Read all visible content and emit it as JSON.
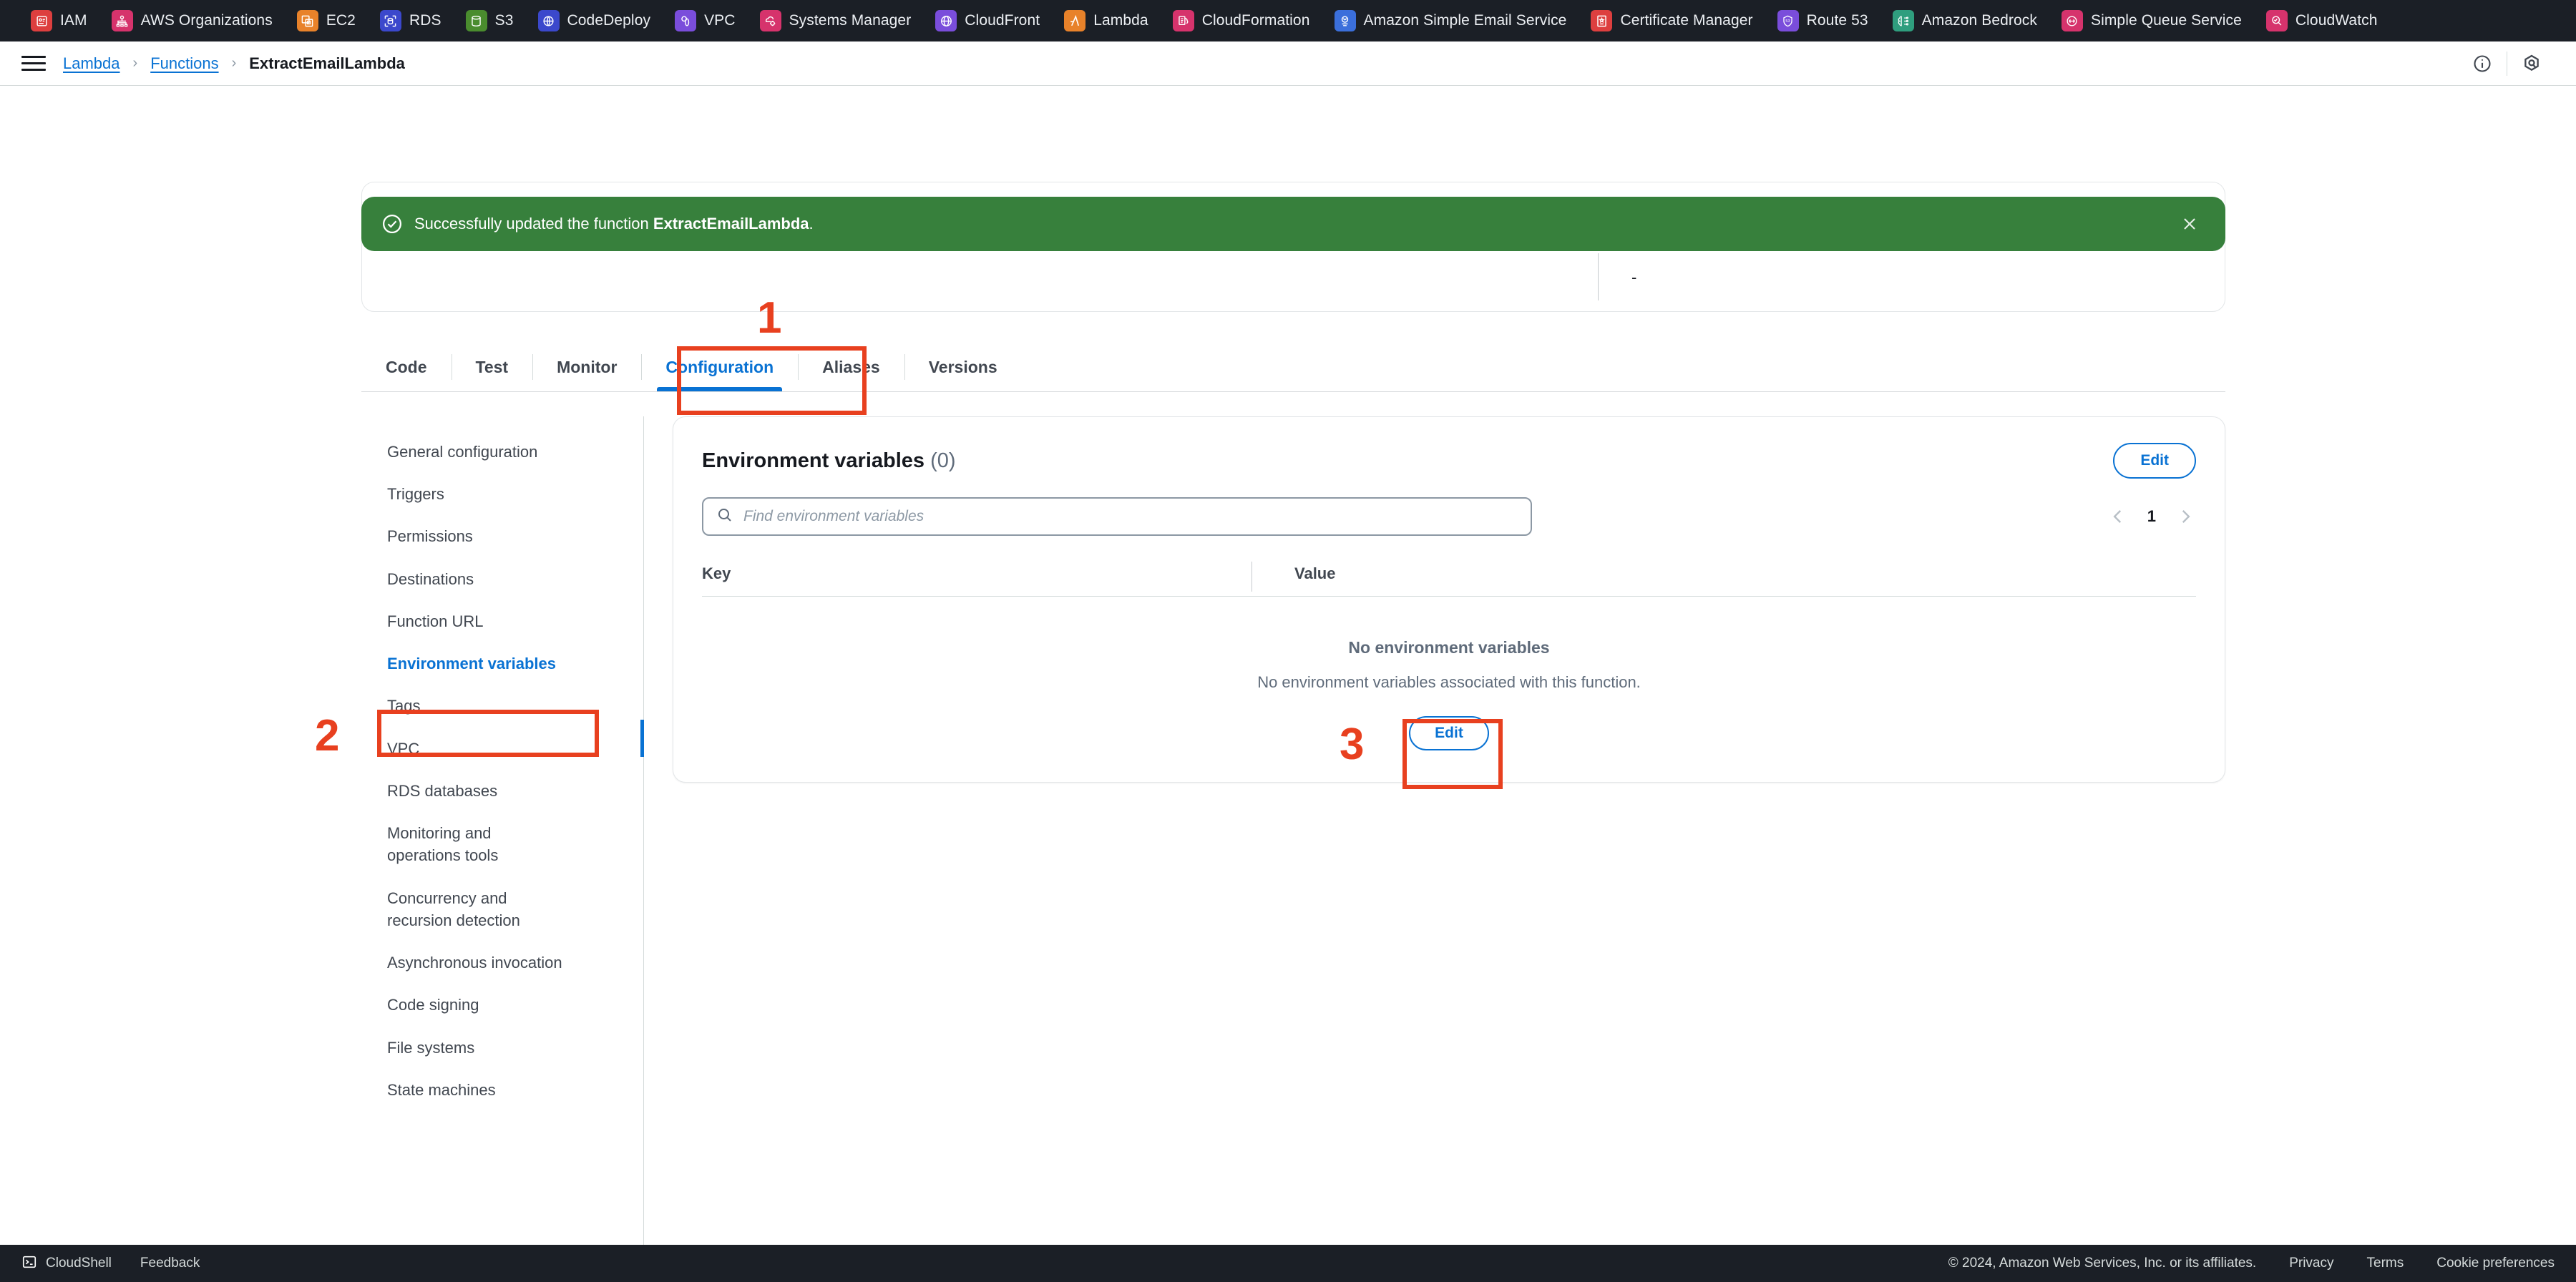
{
  "bookmarks": [
    {
      "label": "IAM",
      "icon": "iam-icon",
      "color": "#dd3f3f"
    },
    {
      "label": "AWS Organizations",
      "icon": "organizations-icon",
      "color": "#d6336c"
    },
    {
      "label": "EC2",
      "icon": "ec2-icon",
      "color": "#e8822a"
    },
    {
      "label": "RDS",
      "icon": "rds-icon",
      "color": "#3b48cc"
    },
    {
      "label": "S3",
      "icon": "s3-icon",
      "color": "#4a8c2e"
    },
    {
      "label": "CodeDeploy",
      "icon": "codedeploy-icon",
      "color": "#3b48cc"
    },
    {
      "label": "VPC",
      "icon": "vpc-icon",
      "color": "#7a4ddb"
    },
    {
      "label": "Systems Manager",
      "icon": "systems-manager-icon",
      "color": "#d6336c"
    },
    {
      "label": "CloudFront",
      "icon": "cloudfront-icon",
      "color": "#7a4ddb"
    },
    {
      "label": "Lambda",
      "icon": "lambda-icon",
      "color": "#e8822a"
    },
    {
      "label": "CloudFormation",
      "icon": "cloudformation-icon",
      "color": "#d6336c"
    },
    {
      "label": "Amazon Simple Email Service",
      "icon": "ses-icon",
      "color": "#3b6fdb"
    },
    {
      "label": "Certificate Manager",
      "icon": "certificate-manager-icon",
      "color": "#dd3f3f"
    },
    {
      "label": "Route 53",
      "icon": "route53-icon",
      "color": "#7a4ddb"
    },
    {
      "label": "Amazon Bedrock",
      "icon": "bedrock-icon",
      "color": "#2f9e7e"
    },
    {
      "label": "Simple Queue Service",
      "icon": "sqs-icon",
      "color": "#d6336c"
    },
    {
      "label": "CloudWatch",
      "icon": "cloudwatch-icon",
      "color": "#d6336c"
    }
  ],
  "header": {
    "menu_icon": "hamburger-icon",
    "breadcrumb": {
      "service": "Lambda",
      "section": "Functions",
      "current": "ExtractEmailLambda",
      "separator": "›"
    },
    "info_icon": "info-icon",
    "settings_icon": "settings-icon"
  },
  "flash": {
    "icon": "success-check-icon",
    "message_prefix": "Successfully updated the function ",
    "message_bold": "ExtractEmailLambda",
    "message_suffix": ".",
    "close_icon": "close-icon",
    "color": "#37803c"
  },
  "ghost": {
    "value": "-"
  },
  "tabs": [
    {
      "label": "Code",
      "active": false
    },
    {
      "label": "Test",
      "active": false
    },
    {
      "label": "Monitor",
      "active": false
    },
    {
      "label": "Configuration",
      "active": true
    },
    {
      "label": "Aliases",
      "active": false
    },
    {
      "label": "Versions",
      "active": false
    }
  ],
  "sidebar": {
    "items": [
      {
        "label": "General configuration",
        "active": false
      },
      {
        "label": "Triggers",
        "active": false
      },
      {
        "label": "Permissions",
        "active": false
      },
      {
        "label": "Destinations",
        "active": false
      },
      {
        "label": "Function URL",
        "active": false
      },
      {
        "label": "Environment variables",
        "active": true
      },
      {
        "label": "Tags",
        "active": false
      },
      {
        "label": "VPC",
        "active": false
      },
      {
        "label": "RDS databases",
        "active": false
      },
      {
        "label": "Monitoring and operations tools",
        "active": false
      },
      {
        "label": "Concurrency and recursion detection",
        "active": false
      },
      {
        "label": "Asynchronous invocation",
        "active": false
      },
      {
        "label": "Code signing",
        "active": false
      },
      {
        "label": "File systems",
        "active": false
      },
      {
        "label": "State machines",
        "active": false
      }
    ]
  },
  "main": {
    "title": "Environment variables",
    "count": "(0)",
    "edit_label": "Edit",
    "search": {
      "icon": "search-icon",
      "placeholder": "Find environment variables",
      "value": ""
    },
    "pagination": {
      "prev_icon": "chevron-left-icon",
      "page": "1",
      "next_icon": "chevron-right-icon"
    },
    "table": {
      "columns": [
        "Key",
        "Value"
      ],
      "rows": []
    },
    "empty_state": {
      "title": "No environment variables",
      "subtitle": "No environment variables associated with this function.",
      "button_label": "Edit"
    }
  },
  "annotations": [
    {
      "number": "1",
      "target": "configuration-tab"
    },
    {
      "number": "2",
      "target": "environment-variables-sidebar-item"
    },
    {
      "number": "3",
      "target": "empty-state-edit-button"
    }
  ],
  "footer": {
    "cloudshell_label": "CloudShell",
    "cloudshell_icon": "terminal-icon",
    "feedback_label": "Feedback",
    "copyright": "© 2024, Amazon Web Services, Inc. or its affiliates.",
    "links": [
      "Privacy",
      "Terms",
      "Cookie preferences"
    ]
  },
  "colors": {
    "accent_blue": "#0972d3",
    "success_green": "#37803c",
    "annotation_red": "#e8401f",
    "dark_chrome": "#1b1f26"
  }
}
